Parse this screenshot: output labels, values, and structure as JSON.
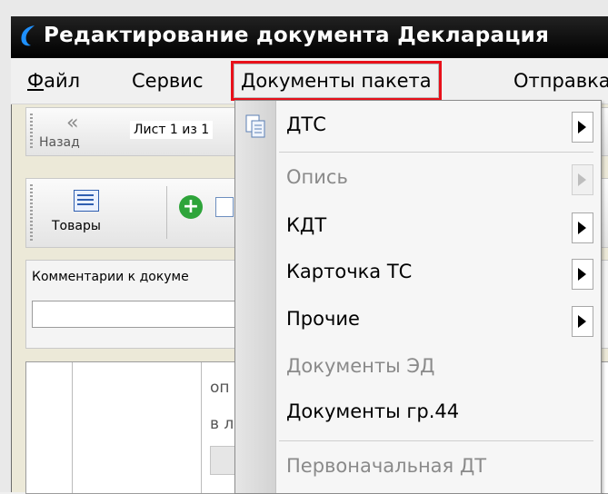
{
  "window": {
    "title": "Редактирование документа Декларация"
  },
  "menubar": {
    "items": [
      {
        "label_accel": "Ф",
        "label_rest": "айл"
      },
      {
        "label": "Сервис"
      },
      {
        "label": "Документы пакета"
      },
      {
        "label": "Отправка"
      }
    ]
  },
  "toolbar1": {
    "back_label": "Назад",
    "sheet_info": "Лист 1 из 1"
  },
  "toolbar2": {
    "goods_label": "Товары"
  },
  "comments": {
    "label": "Комментарии к докуме",
    "value": ""
  },
  "grid": {
    "text1": "оп",
    "text2": "в л"
  },
  "dropdown": {
    "items": [
      {
        "label": "ДТС",
        "enabled": true,
        "submenu": true,
        "icon": "document-copy-icon"
      },
      {
        "label": "Опись",
        "enabled": false,
        "submenu": true
      },
      {
        "label": "КДТ",
        "enabled": true,
        "submenu": true
      },
      {
        "label": "Карточка ТС",
        "enabled": true,
        "submenu": true
      },
      {
        "label": "Прочие",
        "enabled": true,
        "submenu": true
      },
      {
        "label": "Документы ЭД",
        "enabled": false,
        "submenu": false
      },
      {
        "label": "Документы гр.44",
        "enabled": true,
        "submenu": false
      },
      {
        "label": "Первоначальная ДТ",
        "enabled": false,
        "submenu": false
      }
    ]
  },
  "colors": {
    "highlight_border": "#e8101a",
    "disabled_text": "#8a8a8a"
  }
}
